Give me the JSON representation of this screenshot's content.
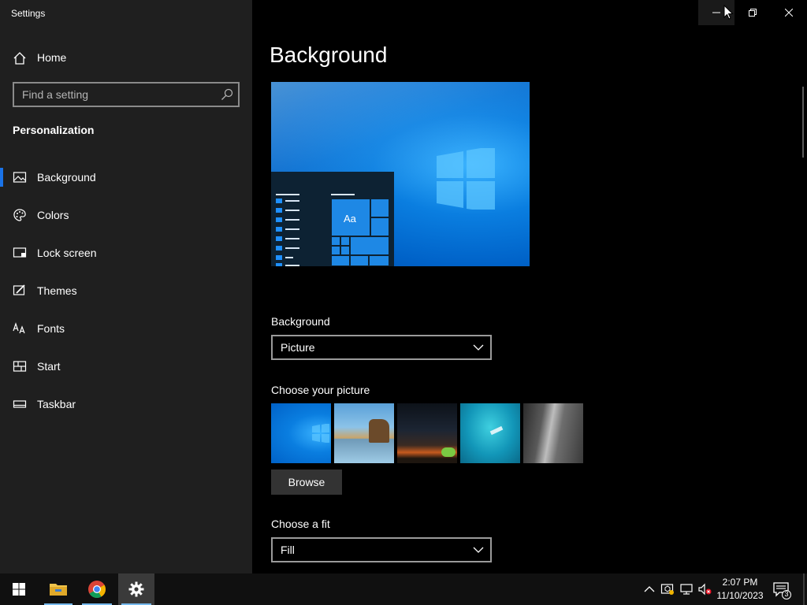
{
  "window": {
    "title": "Settings",
    "controls": {
      "minimize": "minimize",
      "restore": "restore",
      "close": "close"
    }
  },
  "sidebar": {
    "home_label": "Home",
    "search_placeholder": "Find a setting",
    "section_title": "Personalization",
    "items": [
      {
        "label": "Background",
        "icon": "picture-icon",
        "active": true
      },
      {
        "label": "Colors",
        "icon": "palette-icon",
        "active": false
      },
      {
        "label": "Lock screen",
        "icon": "lock-screen-icon",
        "active": false
      },
      {
        "label": "Themes",
        "icon": "brush-icon",
        "active": false
      },
      {
        "label": "Fonts",
        "icon": "font-icon",
        "active": false
      },
      {
        "label": "Start",
        "icon": "start-icon",
        "active": false
      },
      {
        "label": "Taskbar",
        "icon": "taskbar-icon",
        "active": false
      }
    ]
  },
  "main": {
    "page_title": "Background",
    "preview_sample_text": "Aa",
    "background_label": "Background",
    "background_value": "Picture",
    "choose_picture_label": "Choose your picture",
    "browse_label": "Browse",
    "choose_fit_label": "Choose a fit",
    "fit_value": "Fill"
  },
  "taskbar": {
    "apps": [
      {
        "name": "start",
        "icon": "windows-logo-icon"
      },
      {
        "name": "file-explorer",
        "icon": "folder-icon"
      },
      {
        "name": "chrome",
        "icon": "chrome-icon"
      },
      {
        "name": "settings",
        "icon": "gear-icon",
        "active": true
      }
    ],
    "time": "2:07 PM",
    "date": "11/10/2023",
    "notification_count": "3"
  },
  "colors": {
    "accent": "#1a73e8",
    "sidebar_bg": "#1f1f1f",
    "main_bg": "#000000",
    "taskbar_bg": "#101010"
  }
}
